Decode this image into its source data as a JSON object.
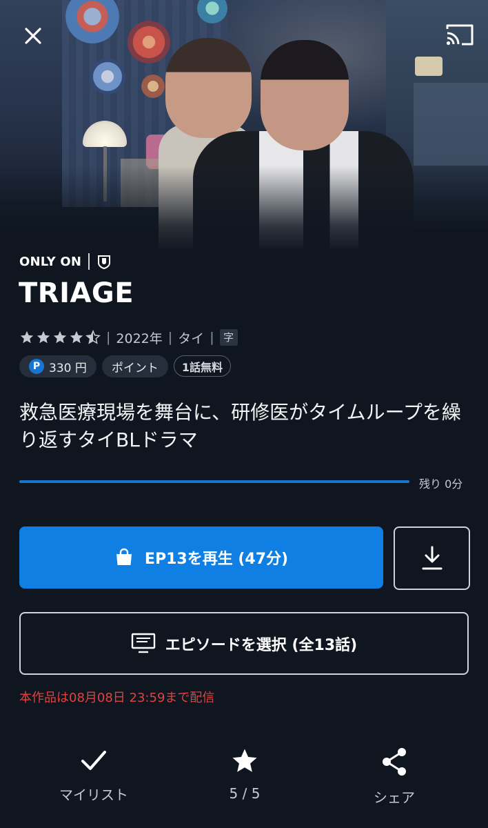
{
  "hero": {
    "image_alt": "Two men in a dimly lit room"
  },
  "header": {
    "close_icon": "close-icon",
    "cast_icon": "cast-icon"
  },
  "only_on": {
    "text": "ONLY ON",
    "brand_icon": "shield-logo-icon"
  },
  "title": "TRIAGE",
  "meta": {
    "rating_stars": 4.5,
    "year": "2022年",
    "country": "タイ",
    "subtitle_badge": "字"
  },
  "badges": {
    "price": "330 円",
    "points": "ポイント",
    "free": "1話無料"
  },
  "description": "救急医療現場を舞台に、研修医がタイムループを繰り返すタイBLドラマ",
  "progress": {
    "fraction_watched": 1.0,
    "remaining": "残り 0分"
  },
  "play_button": {
    "label": "EP13を再生 (47分)",
    "icon": "shopping-bag-icon"
  },
  "download_button": {
    "icon": "download-icon"
  },
  "episode_button": {
    "label": "エピソードを選択 (全13話)",
    "icon": "monitor-icon"
  },
  "availability": "本作品は08月08日 23:59まで配信",
  "actions": {
    "mylist": {
      "label": "マイリスト",
      "icon": "check-icon"
    },
    "rating": {
      "label": "5 / 5",
      "icon": "star-icon"
    },
    "share": {
      "label": "シェア",
      "icon": "share-icon"
    }
  },
  "colors": {
    "background": "#0f1620",
    "accent": "#0f7fe3",
    "warning": "#e2423f",
    "badge_bg": "#262e3b"
  }
}
